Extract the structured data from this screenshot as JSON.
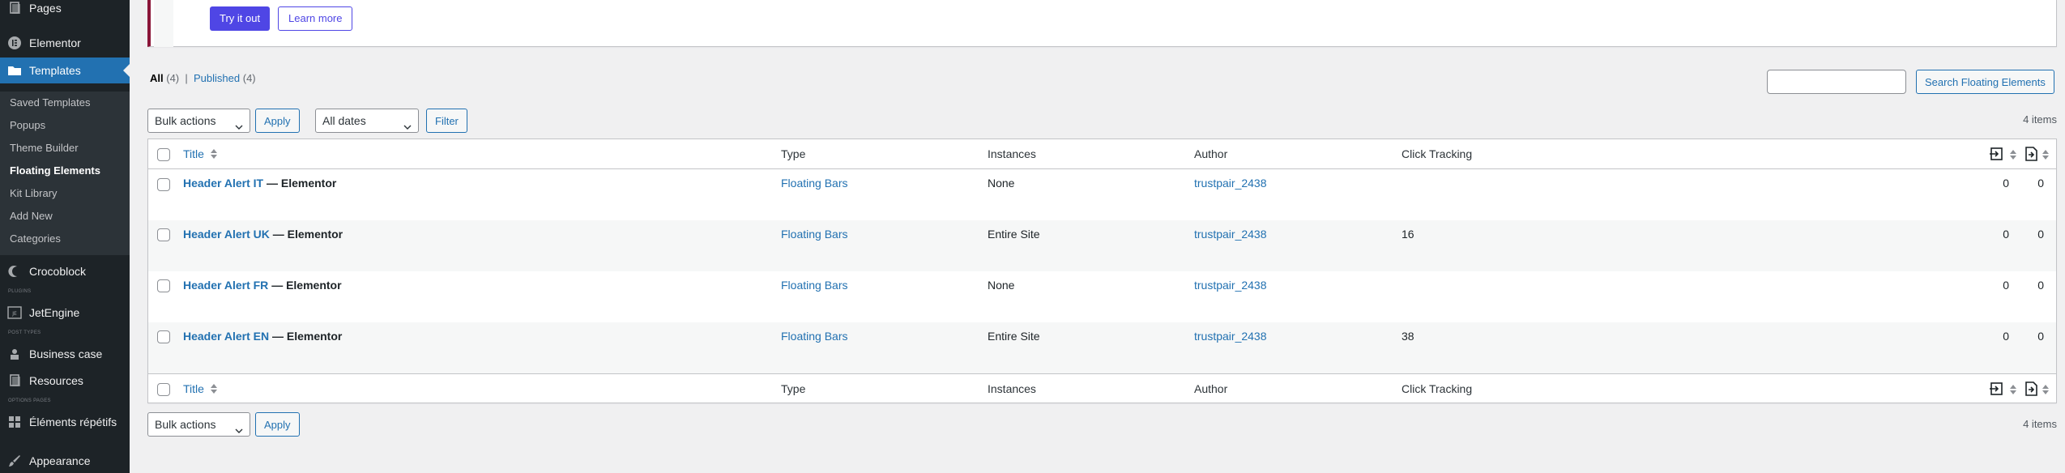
{
  "sidebar": {
    "items": [
      {
        "id": "pages",
        "label": "Pages",
        "icon": "pages-icon"
      },
      {
        "id": "elementor",
        "label": "Elementor",
        "icon": "elementor-icon"
      },
      {
        "id": "templates",
        "label": "Templates",
        "icon": "folder-icon"
      },
      {
        "id": "crocoblock",
        "label": "Crocoblock",
        "icon": "crocoblock-icon"
      },
      {
        "id": "jetengine",
        "label": "JetEngine",
        "icon": "jetengine-icon"
      },
      {
        "id": "business-case",
        "label": "Business case",
        "icon": "pin-icon"
      },
      {
        "id": "resources",
        "label": "Resources",
        "icon": "pages-icon"
      },
      {
        "id": "elements-repetitifs",
        "label": "Éléments répétifs",
        "icon": "grid-icon"
      },
      {
        "id": "appearance",
        "label": "Appearance",
        "icon": "brush-icon"
      }
    ],
    "submenu": [
      {
        "label": "Saved Templates"
      },
      {
        "label": "Popups"
      },
      {
        "label": "Theme Builder"
      },
      {
        "label": "Floating Elements"
      },
      {
        "label": "Kit Library"
      },
      {
        "label": "Add New"
      },
      {
        "label": "Categories"
      }
    ],
    "separators": [
      "PLUGINS",
      "POST TYPES",
      "OPTIONS PAGES"
    ]
  },
  "notice": {
    "try_label": "Try it out",
    "learn_label": "Learn more"
  },
  "views": {
    "all_label": "All",
    "all_count": "(4)",
    "sep": "|",
    "published_label": "Published",
    "published_count": "(4)"
  },
  "search": {
    "button_label": "Search Floating Elements",
    "placeholder": ""
  },
  "filters": {
    "bulk_actions": "Bulk actions",
    "apply_label": "Apply",
    "all_dates": "All dates",
    "filter_label": "Filter",
    "items_count": "4 items"
  },
  "table": {
    "columns": {
      "title": "Title",
      "type": "Type",
      "instances": "Instances",
      "author": "Author",
      "click_tracking": "Click Tracking"
    },
    "rows": [
      {
        "title": "Header Alert IT",
        "state": "— Elementor",
        "type": "Floating Bars",
        "instances": "None",
        "author": "trustpair_2438",
        "clicks": "",
        "a": "0",
        "b": "0"
      },
      {
        "title": "Header Alert UK",
        "state": "— Elementor",
        "type": "Floating Bars",
        "instances": "Entire Site",
        "author": "trustpair_2438",
        "clicks": "16",
        "a": "0",
        "b": "0"
      },
      {
        "title": "Header Alert FR",
        "state": "— Elementor",
        "type": "Floating Bars",
        "instances": "None",
        "author": "trustpair_2438",
        "clicks": "",
        "a": "0",
        "b": "0"
      },
      {
        "title": "Header Alert EN",
        "state": "— Elementor",
        "type": "Floating Bars",
        "instances": "Entire Site",
        "author": "trustpair_2438",
        "clicks": "38",
        "a": "0",
        "b": "0"
      }
    ]
  },
  "colors": {
    "sidebar_bg": "#1d2327",
    "accent": "#2271b1",
    "notice_button": "#4f46e5"
  }
}
